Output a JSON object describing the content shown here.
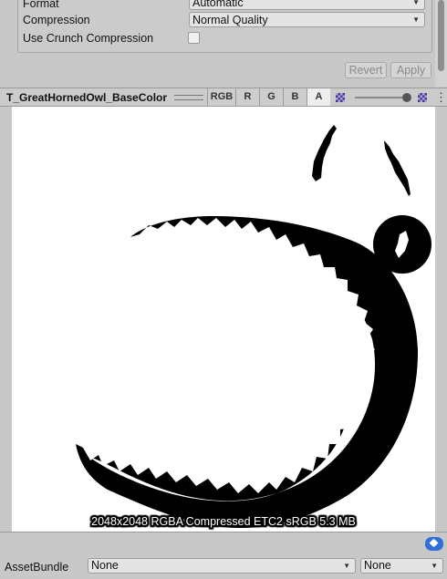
{
  "import_settings": {
    "format_label": "Format",
    "format_value": "Automatic",
    "compression_label": "Compression",
    "compression_value": "Normal Quality",
    "crunch_label": "Use Crunch Compression",
    "crunch_checked": false,
    "revert_label": "Revert",
    "apply_label": "Apply"
  },
  "preview": {
    "title": "T_GreatHornedOwl_BaseColor",
    "channels": [
      "RGB",
      "R",
      "G",
      "B",
      "A"
    ],
    "active_channel": "A",
    "more_glyph": "⋮",
    "info": "2048x2048  RGBA Compressed ETC2 sRGB  5.3 MB"
  },
  "asset_bundle": {
    "label": "AssetBundle",
    "name_value": "None",
    "variant_value": "None"
  },
  "icons": {
    "dropdown": "chevron-down-icon",
    "checker": "checkerboard-icon",
    "tag": "tag-icon"
  },
  "colors": {
    "panel_bg": "#c8c8c8",
    "tag_blue": "#2f6fd6",
    "alpha_mask": "#000000"
  }
}
